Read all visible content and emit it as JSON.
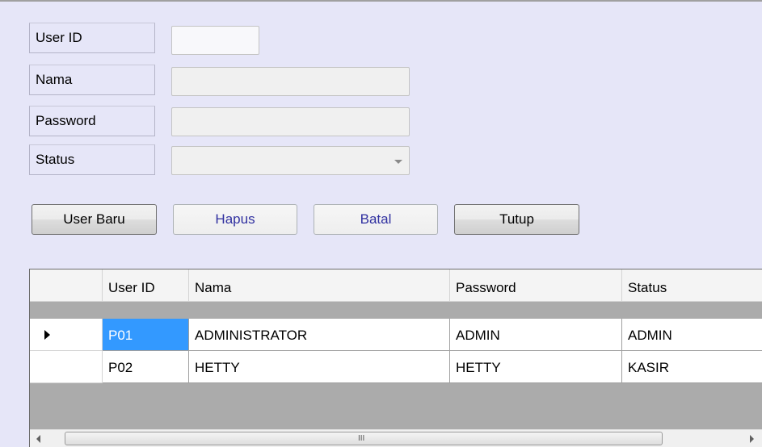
{
  "form": {
    "userid_label": "User ID",
    "nama_label": "Nama",
    "password_label": "Password",
    "status_label": "Status",
    "userid_value": "",
    "nama_value": "",
    "password_value": "",
    "status_value": ""
  },
  "buttons": {
    "user_baru": "User Baru",
    "hapus": "Hapus",
    "batal": "Batal",
    "tutup": "Tutup"
  },
  "grid": {
    "columns": [
      "User ID",
      "Nama",
      "Password",
      "Status"
    ],
    "rows": [
      {
        "user_id": "P01",
        "nama": "ADMINISTRATOR",
        "password": "ADMIN",
        "status": "ADMIN"
      },
      {
        "user_id": "P02",
        "nama": "HETTY",
        "password": "HETTY",
        "status": "KASIR"
      }
    ],
    "scroll_grip": "III"
  },
  "colors": {
    "form_background": "#e6e6f8",
    "selection": "#3399ff",
    "empty_grid_area": "#ababab",
    "disabled_button_text": "#3030a0"
  }
}
